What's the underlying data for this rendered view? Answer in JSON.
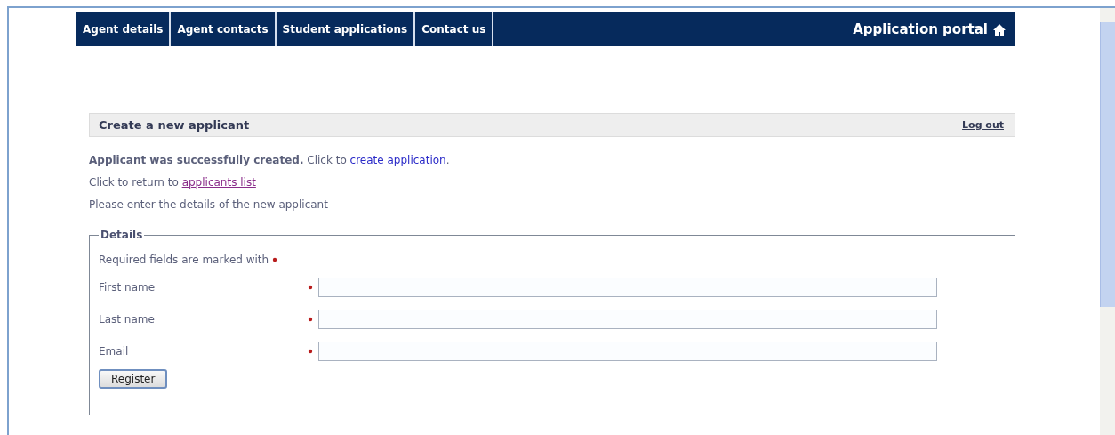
{
  "nav": {
    "tabs": [
      {
        "label": "Agent details"
      },
      {
        "label": "Agent contacts"
      },
      {
        "label": "Student applications"
      },
      {
        "label": "Contact us"
      }
    ],
    "brand": "Application portal"
  },
  "panel": {
    "title": "Create a new applicant",
    "logout": "Log out"
  },
  "messages": [
    {
      "lead": "**Applicant was successfully created.** Click to ",
      "link": "create application",
      "visited": false,
      "tail": "."
    },
    {
      "lead": "Click to return to ",
      "link": "applicants list",
      "visited": true
    },
    {
      "lead": "Please enter the details of the new applicant"
    }
  ],
  "details": {
    "legend": "Details",
    "note": "Required fields are marked with",
    "fields": [
      {
        "label": "First name",
        "required": true
      },
      {
        "label": "Last name",
        "required": true
      },
      {
        "label": "Email",
        "required": true
      }
    ],
    "button": "Register"
  }
}
